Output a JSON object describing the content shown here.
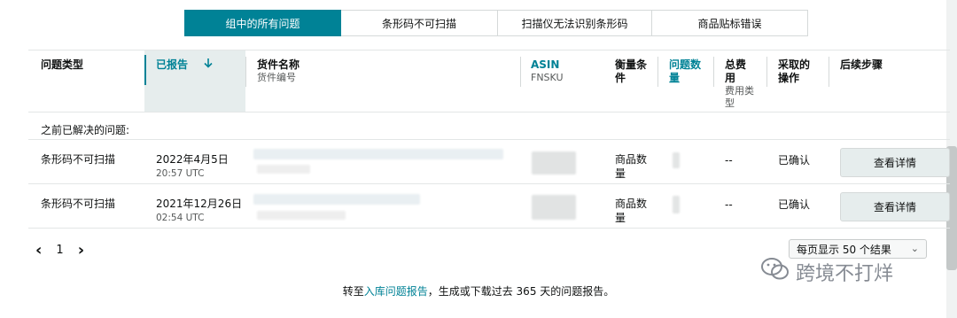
{
  "tabs": [
    {
      "label": "组中的所有问题",
      "active": true
    },
    {
      "label": "条形码不可扫描",
      "active": false
    },
    {
      "label": "扫描仪无法识别条形码",
      "active": false
    },
    {
      "label": "商品贴标错误",
      "active": false
    }
  ],
  "columns": {
    "issue_type": "问题类型",
    "reported": "已报告",
    "sort_icon": "arrow-down-icon",
    "item_name": "货件名称",
    "item_id": "货件编号",
    "asin": "ASIN",
    "fnsku": "FNSKU",
    "measure_a": "衡量条",
    "measure_b": "件",
    "issue_qty_a": "问题数",
    "issue_qty_b": "量",
    "total_fee_a": "总费",
    "total_fee_b": "用",
    "fee_type_a": "费用类",
    "fee_type_b": "型",
    "action_a": "采取的",
    "action_b": "操作",
    "next_steps": "后续步骤"
  },
  "section_label": "之前已解决的问题:",
  "rows": [
    {
      "issue_type": "条形码不可扫描",
      "date": "2022年4月5日",
      "time": "20:57 UTC",
      "measure_a": "商品数",
      "measure_b": "量",
      "total_fee": "--",
      "action": "已确认",
      "button": "查看详情"
    },
    {
      "issue_type": "条形码不可扫描",
      "date": "2021年12月26日",
      "time": "02:54 UTC",
      "measure_a": "商品数",
      "measure_b": "量",
      "total_fee": "--",
      "action": "已确认",
      "button": "查看详情"
    }
  ],
  "pagination": {
    "prev": "‹",
    "page": "1",
    "next": "›"
  },
  "per_page": "每页显示 50 个结果",
  "footer": {
    "before": "转至",
    "link": "入库问题报告",
    "after": "，生成或下载过去 365 天的问题报告。"
  },
  "watermark": "跨境不打烊",
  "colors": {
    "accent": "#008296"
  }
}
